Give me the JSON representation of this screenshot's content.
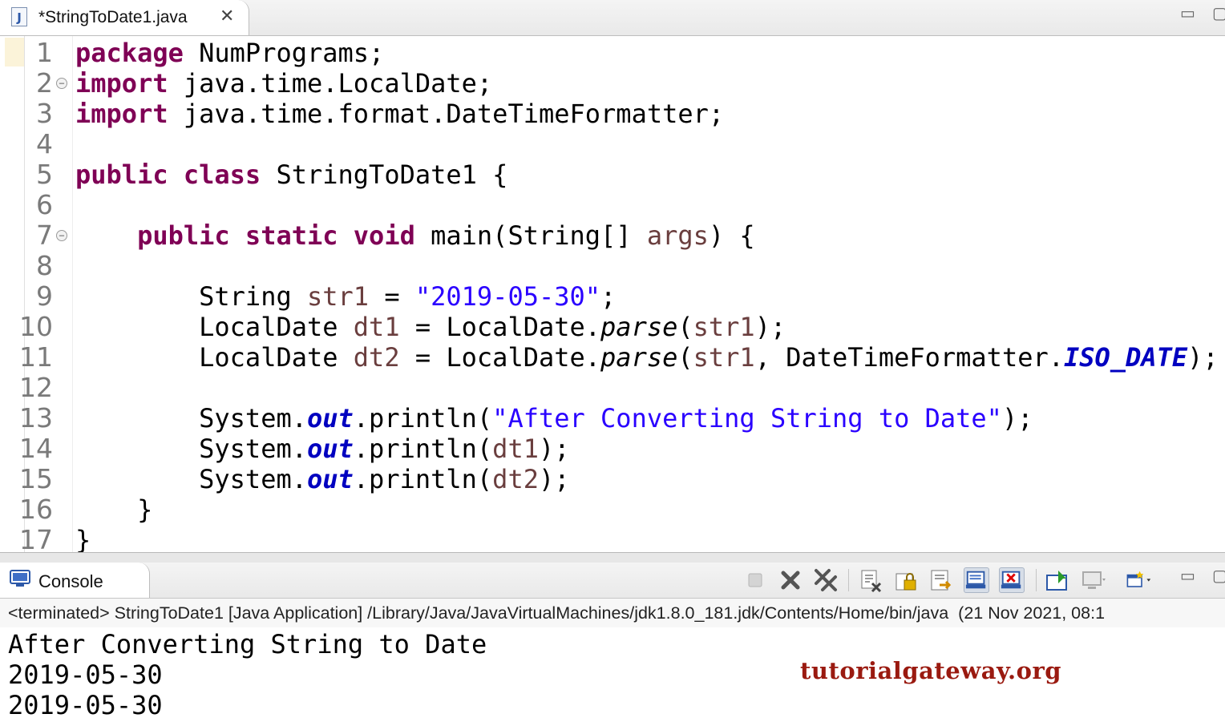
{
  "editor_tab": {
    "title": "*StringToDate1.java",
    "icon": "java-file-icon",
    "close_glyph": "✕"
  },
  "editor": {
    "line_numbers": [
      "1",
      "2",
      "3",
      "4",
      "5",
      "6",
      "7",
      "8",
      "9",
      "10",
      "11",
      "12",
      "13",
      "14",
      "15",
      "16",
      "17"
    ],
    "lines": [
      [
        {
          "t": "package",
          "c": "kw"
        },
        {
          "t": " NumPrograms;"
        }
      ],
      [
        {
          "t": "import",
          "c": "kw"
        },
        {
          "t": " java.time.LocalDate;"
        }
      ],
      [
        {
          "t": "import",
          "c": "kw"
        },
        {
          "t": " java.time.format.DateTimeFormatter;"
        }
      ],
      [],
      [
        {
          "t": "public",
          "c": "kw"
        },
        {
          "t": " "
        },
        {
          "t": "class",
          "c": "kw"
        },
        {
          "t": " StringToDate1 {"
        }
      ],
      [],
      [
        {
          "t": "    "
        },
        {
          "t": "public",
          "c": "kw"
        },
        {
          "t": " "
        },
        {
          "t": "static",
          "c": "kw"
        },
        {
          "t": " "
        },
        {
          "t": "void",
          "c": "kw"
        },
        {
          "t": " main(String[] "
        },
        {
          "t": "args",
          "c": "var"
        },
        {
          "t": ") {"
        }
      ],
      [],
      [
        {
          "t": "        String "
        },
        {
          "t": "str1",
          "c": "var"
        },
        {
          "t": " = "
        },
        {
          "t": "\"2019-05-30\"",
          "c": "str"
        },
        {
          "t": ";"
        }
      ],
      [
        {
          "t": "        LocalDate "
        },
        {
          "t": "dt1",
          "c": "var"
        },
        {
          "t": " = LocalDate."
        },
        {
          "t": "parse",
          "c": "meth"
        },
        {
          "t": "("
        },
        {
          "t": "str1",
          "c": "var"
        },
        {
          "t": ");"
        }
      ],
      [
        {
          "t": "        LocalDate "
        },
        {
          "t": "dt2",
          "c": "var"
        },
        {
          "t": " = LocalDate."
        },
        {
          "t": "parse",
          "c": "meth"
        },
        {
          "t": "("
        },
        {
          "t": "str1",
          "c": "var"
        },
        {
          "t": ", DateTimeFormatter."
        },
        {
          "t": "ISO_DATE",
          "c": "stat"
        },
        {
          "t": ");"
        }
      ],
      [],
      [
        {
          "t": "        System."
        },
        {
          "t": "out",
          "c": "stat"
        },
        {
          "t": ".println("
        },
        {
          "t": "\"After Converting String to Date\"",
          "c": "str"
        },
        {
          "t": ");"
        }
      ],
      [
        {
          "t": "        System."
        },
        {
          "t": "out",
          "c": "stat"
        },
        {
          "t": ".println("
        },
        {
          "t": "dt1",
          "c": "var"
        },
        {
          "t": ");"
        }
      ],
      [
        {
          "t": "        System."
        },
        {
          "t": "out",
          "c": "stat"
        },
        {
          "t": ".println("
        },
        {
          "t": "dt2",
          "c": "var"
        },
        {
          "t": ");"
        }
      ],
      [
        {
          "t": "    }"
        }
      ],
      [
        {
          "t": "}"
        }
      ]
    ],
    "fold_lines": [
      2,
      7
    ],
    "syntax_colors": {
      "keyword": "#7f0055",
      "string": "#2a00ff",
      "local_variable": "#6a3e3e",
      "static_field": "#0000c0"
    }
  },
  "console": {
    "tab_title": "Console",
    "status": "<terminated> StringToDate1 [Java Application] /Library/Java/JavaVirtualMachines/jdk1.8.0_181.jdk/Contents/Home/bin/java  (21 Nov 2021, 08:1",
    "output": [
      "After Converting String to Date",
      "2019-05-30",
      "2019-05-30"
    ],
    "toolbar": [
      "terminate-icon",
      "remove-launch-icon",
      "remove-all-terminated-icon",
      "clear-console-icon",
      "scroll-lock-icon",
      "word-wrap-icon",
      "show-on-stdout-icon",
      "show-on-stderr-icon",
      "pin-console-icon",
      "display-selected-console-icon",
      "open-console-icon"
    ]
  },
  "watermark": "tutorialgateway.org"
}
